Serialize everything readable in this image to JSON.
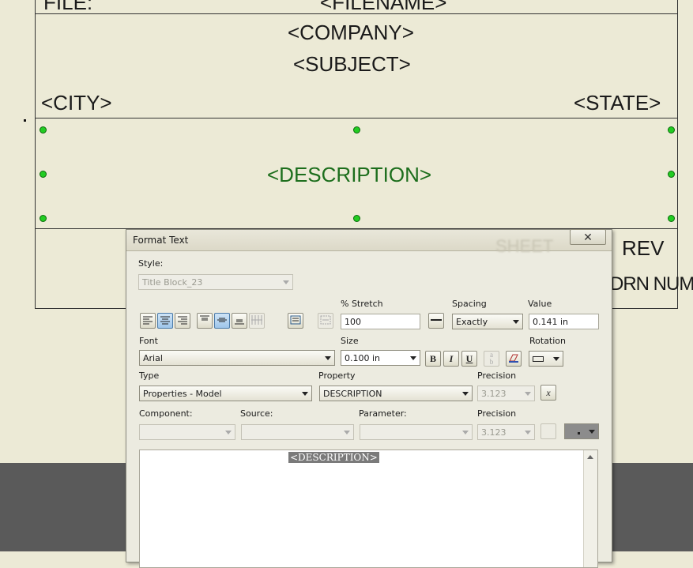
{
  "title_block": {
    "file_label": "FILE:",
    "filename": "<FILENAME>",
    "company": "<COMPANY>",
    "subject": "<SUBJECT>",
    "city": "<CITY>",
    "state": "<STATE>",
    "description": "<DESCRIPTION>",
    "rev": "REV",
    "sheet_partial": "SHEET",
    "overlap_text": "DRN NUM"
  },
  "dialog": {
    "title": "Format Text",
    "close_icon": "close-icon",
    "style_label": "Style:",
    "style_value": "Title Block_23",
    "stretch_label": "% Stretch",
    "stretch_value": "100",
    "spacing_label": "Spacing",
    "spacing_value": "Exactly",
    "value_label": "Value",
    "value_value": "0.141 in",
    "font_label": "Font",
    "font_value": "Arial",
    "size_label": "Size",
    "size_value": "0.100 in",
    "rotation_label": "Rotation",
    "bold": "B",
    "italic": "I",
    "underline": "U",
    "type_label": "Type",
    "type_value": "Properties - Model",
    "property_label": "Property",
    "property_value": "DESCRIPTION",
    "precision_label": "Precision",
    "precision_value": "3.123",
    "component_label": "Component:",
    "source_label": "Source:",
    "parameter_label": "Parameter:",
    "precision2_label": "Precision",
    "precision2_value": "3.123",
    "text_content": "<DESCRIPTION>"
  }
}
